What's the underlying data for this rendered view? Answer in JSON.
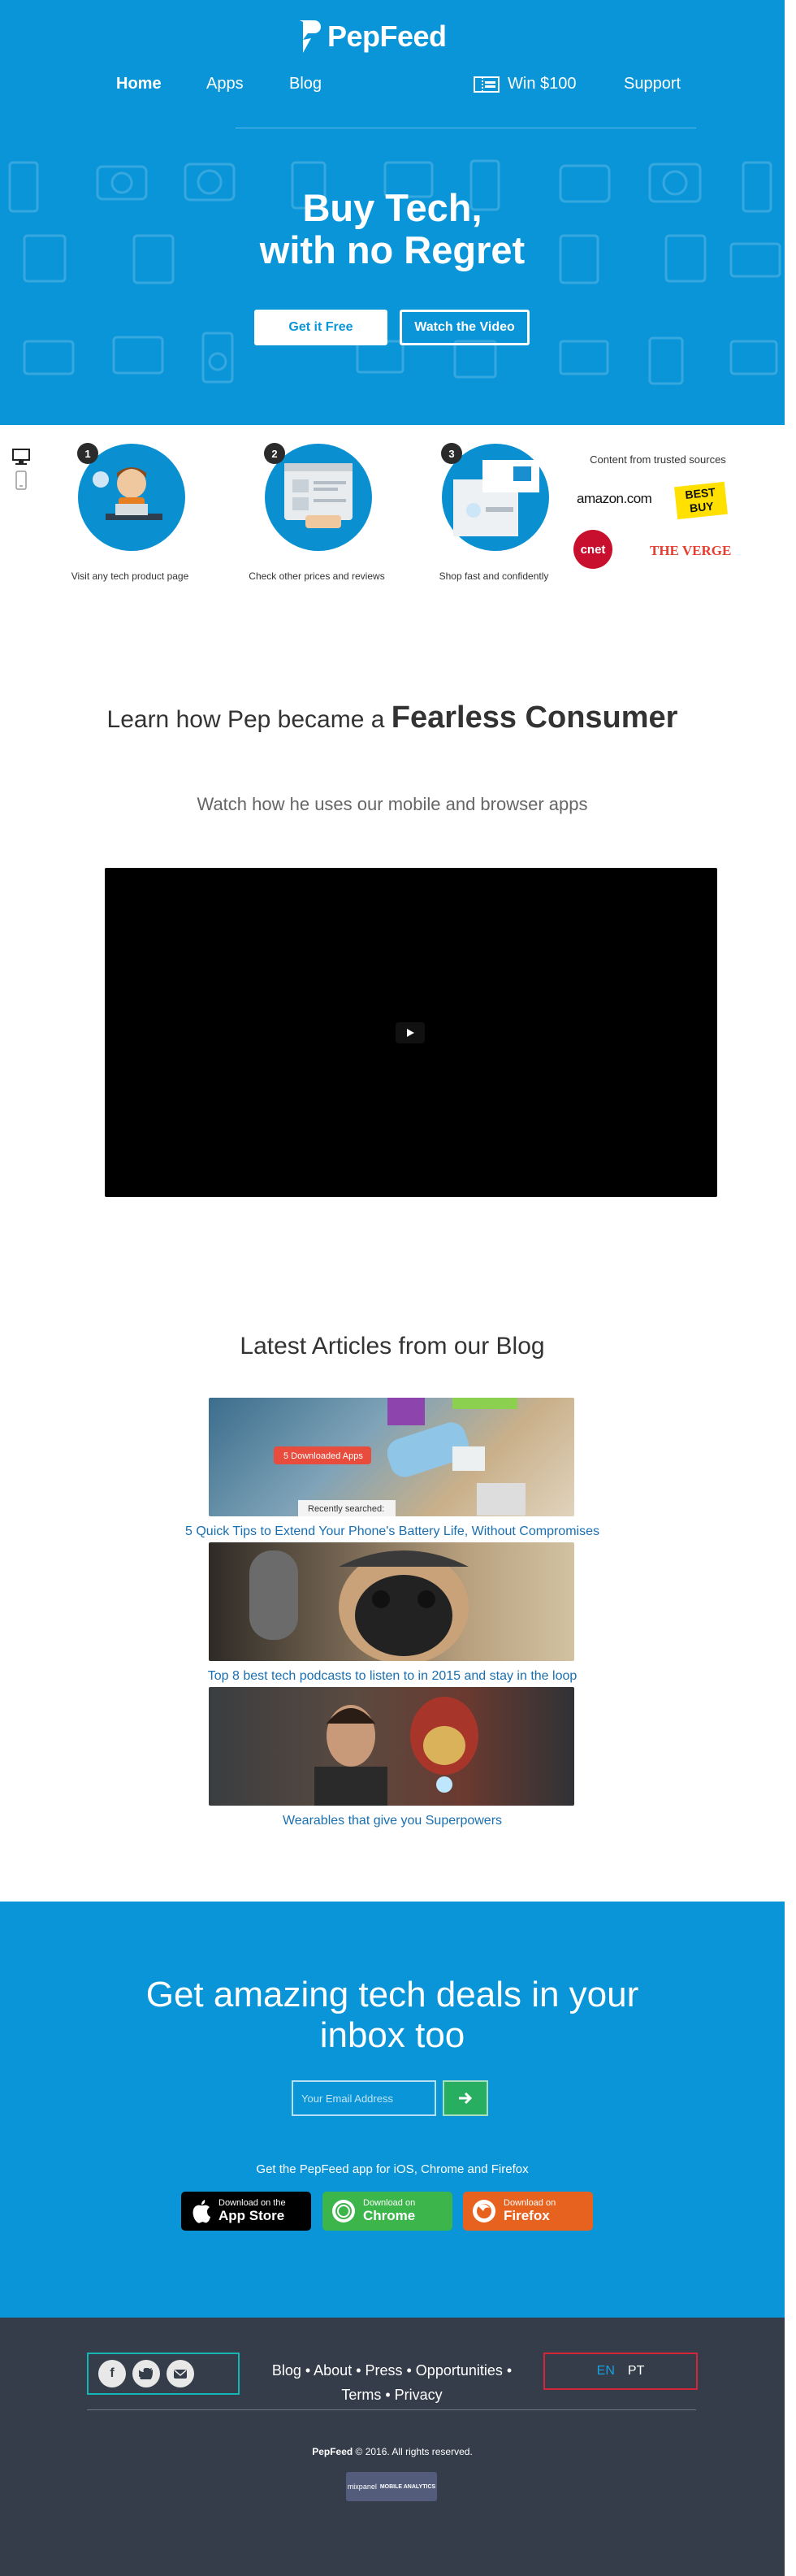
{
  "brand": {
    "name": "PepFeed"
  },
  "nav": {
    "items": [
      {
        "label": "Home",
        "active": true
      },
      {
        "label": "Apps",
        "active": false
      },
      {
        "label": "Blog",
        "active": false
      },
      {
        "label": "Win $100",
        "active": false,
        "icon": "ticket-icon"
      },
      {
        "label": "Support",
        "active": false
      }
    ]
  },
  "hero": {
    "title_line1": "Buy Tech,",
    "title_line2": "with no Regret",
    "cta_primary": "Get it Free",
    "cta_secondary": "Watch the Video"
  },
  "steps": [
    {
      "number": "1",
      "label": "Visit any tech product page"
    },
    {
      "number": "2",
      "label": "Check other prices and reviews"
    },
    {
      "number": "3",
      "label": "Shop fast and confidently"
    }
  ],
  "sources": {
    "title": "Content from trusted sources",
    "logos": [
      "amazon.com",
      "BEST BUY",
      "cnet",
      "THE VERGE"
    ]
  },
  "fearless": {
    "prefix": "Learn how Pep became a",
    "emphasis": "Fearless Consumer",
    "subtitle": "Watch how he uses our mobile and browser apps"
  },
  "blog": {
    "title": "Latest Articles from our Blog",
    "articles": [
      {
        "title": "5 Quick Tips to Extend Your Phone's Battery Life, Without Compromises",
        "thumb_text_1": "5 Downloaded Apps",
        "thumb_text_2": "Recently searched:"
      },
      {
        "title": "Top 8 best tech podcasts to listen to in 2015 and stay in the loop"
      },
      {
        "title": "Wearables that give you Superpowers"
      }
    ]
  },
  "newsletter": {
    "title_line1": "Get amazing tech deals in your",
    "title_line2": "inbox too",
    "email_placeholder": "Your Email Address",
    "apps_line": "Get the PepFeed app for iOS, Chrome and Firefox",
    "stores": [
      {
        "line1": "Download on the",
        "line2": "App Store",
        "color": "#000000"
      },
      {
        "line1": "Download on",
        "line2": "Chrome",
        "color": "#3cb54a"
      },
      {
        "line1": "Download on",
        "line2": "Firefox",
        "color": "#e8621f"
      }
    ]
  },
  "footer": {
    "links_line1": "Blog • About • Press • Opportunities •",
    "links_line2": "Terms • Privacy",
    "lang_en": "EN",
    "lang_pt": "PT",
    "copyright_brand": "PepFeed",
    "copyright_rest": " © 2016. All rights reserved.",
    "mixpanel_text": "mixpanel",
    "mixpanel_sub": "MOBILE ANALYTICS"
  },
  "colors": {
    "brand_blue": "#0a95d8",
    "footer_bg": "#343d49",
    "accent_green": "#27ae60",
    "link_blue": "#1a6fb0"
  }
}
